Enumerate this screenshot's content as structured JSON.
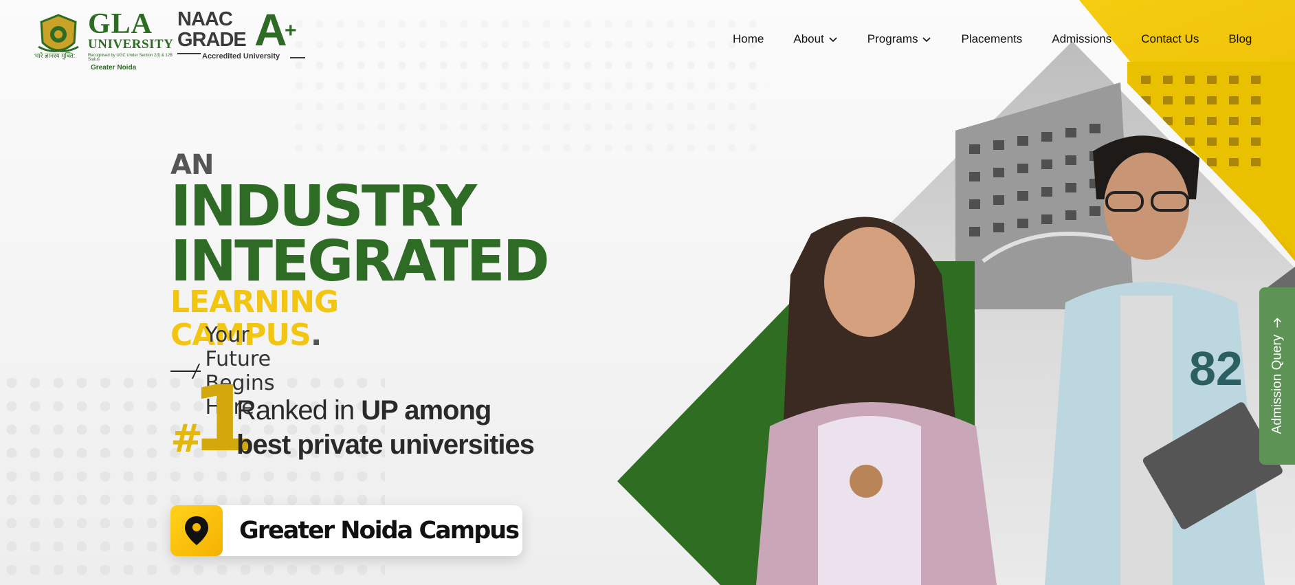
{
  "header": {
    "logo_gla": {
      "big": "GLA",
      "university": "UNIVERSITY",
      "recognized": "Recognised by UGC Under Section 2(f) & 12B Status",
      "location": "Greater Noida",
      "motto": "भारे ज्ञानस्य मुक्ति:"
    },
    "logo_naac": {
      "line1": "NAAC",
      "line2": "GRADE",
      "grade": "A",
      "plus": "+",
      "sub": "Accredited University"
    },
    "nav": [
      {
        "label": "Home",
        "has_dropdown": false
      },
      {
        "label": "About",
        "has_dropdown": true
      },
      {
        "label": "Programs",
        "has_dropdown": true
      },
      {
        "label": "Placements",
        "has_dropdown": false
      },
      {
        "label": "Admissions",
        "has_dropdown": false
      },
      {
        "label": "Contact Us",
        "has_dropdown": false
      },
      {
        "label": "Blog",
        "has_dropdown": false
      }
    ]
  },
  "hero": {
    "an": "AN",
    "line1": "INDUSTRY",
    "line2": "INTEGRATED",
    "line3": "LEARNING CAMPUS",
    "line3_dot": ".",
    "tagline": "Your Future Begins Here"
  },
  "rank": {
    "hash": "#",
    "number": "1",
    "text_a": "Ranked in ",
    "text_b": "UP among",
    "text_c": "best private universities"
  },
  "campus": {
    "label": "Greater Noida Campus",
    "icon": "location-pin-icon"
  },
  "side_tab": {
    "label": "Admission Query",
    "icon": "arrow-up-icon"
  },
  "colors": {
    "green": "#2e6b25",
    "yellow": "#f2c511",
    "gold": "#d2a80c",
    "tab_green": "#5d9456"
  }
}
